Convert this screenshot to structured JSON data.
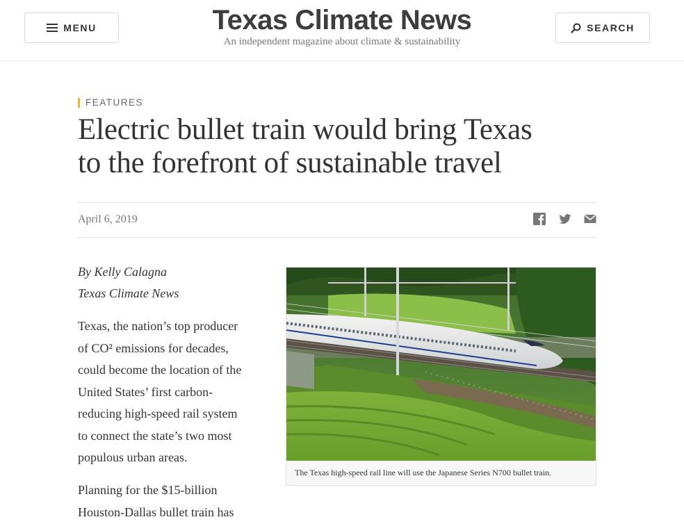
{
  "header": {
    "menu_label": "MENU",
    "search_label": "SEARCH",
    "site_title": "Texas Climate News",
    "tagline": "An independent magazine about climate & sustainability"
  },
  "article": {
    "category": "FEATURES",
    "headline_line1": "Electric bullet train would bring Texas",
    "headline_line2": "to the forefront of sustainable travel",
    "date": "April 6, 2019",
    "share": [
      "facebook-icon",
      "twitter-icon",
      "email-icon"
    ],
    "byline": "By Kelly Calagna",
    "publication": "Texas Climate News",
    "paragraph1": [
      "Texas, the nation’s top producer",
      "of CO² emissions for decades,",
      "could become the location of the",
      "United States’ first carbon-",
      "reducing high-speed rail system",
      "to connect the state’s two most",
      "populous urban areas."
    ],
    "paragraph2": [
      "Planning for the $15-billion",
      "Houston-Dallas bullet train has"
    ],
    "figure_caption": "The Texas high-speed rail line will use the Japanese Series N700 bullet train."
  },
  "colors": {
    "accent": "#f0b429",
    "text": "#333333",
    "muted": "#777777"
  }
}
